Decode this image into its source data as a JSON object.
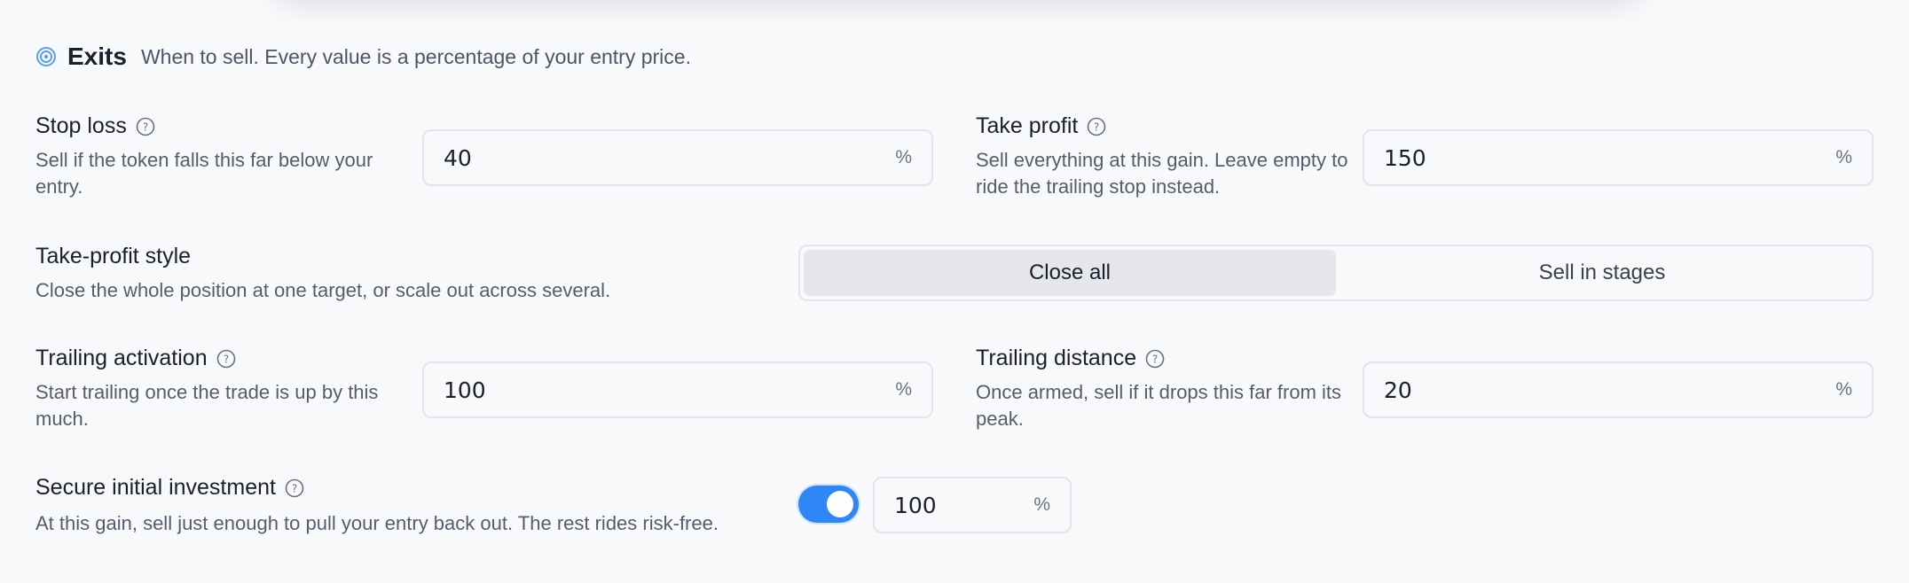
{
  "section": {
    "title": "Exits",
    "subtitle": "When to sell. Every value is a percentage of your entry price.",
    "icon": "target-icon"
  },
  "stop_loss": {
    "title": "Stop loss",
    "description": "Sell if the token falls this far below your entry.",
    "value": "40",
    "unit": "%"
  },
  "take_profit": {
    "title": "Take profit",
    "description": "Sell everything at this gain. Leave empty to ride the trailing stop instead.",
    "value": "150",
    "unit": "%"
  },
  "tp_style": {
    "title": "Take-profit style",
    "description": "Close the whole position at one target, or scale out across several.",
    "options": [
      "Close all",
      "Sell in stages"
    ],
    "selected": "Close all"
  },
  "trailing_activation": {
    "title": "Trailing activation",
    "description": "Start trailing once the trade is up by this much.",
    "value": "100",
    "unit": "%"
  },
  "trailing_distance": {
    "title": "Trailing distance",
    "description": "Once armed, sell if it drops this far from its peak.",
    "value": "20",
    "unit": "%"
  },
  "secure_initial": {
    "title": "Secure initial investment",
    "description": "At this gain, sell just enough to pull your entry back out. The rest rides risk-free.",
    "enabled": true,
    "value": "100",
    "unit": "%"
  },
  "colors": {
    "accent": "#2f86f6",
    "background": "#f8f9fb",
    "border": "#e1e4ea"
  }
}
